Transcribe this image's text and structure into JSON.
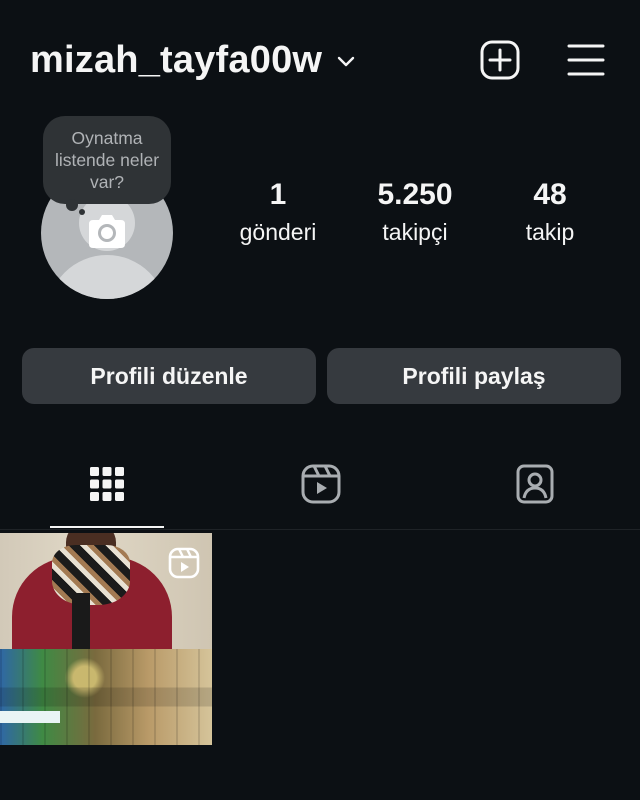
{
  "header": {
    "username": "mizah_tayfa00w",
    "icons": [
      "chevron-down-icon",
      "add-square-icon",
      "hamburger-menu-icon"
    ]
  },
  "profile": {
    "note_text": "Oynatma listende neler var?",
    "avatar_icon": "camera-icon",
    "stats": [
      {
        "value": "1",
        "label": "gönderi"
      },
      {
        "value": "5.250",
        "label": "takipçi"
      },
      {
        "value": "48",
        "label": "takip"
      }
    ]
  },
  "actions": {
    "edit_label": "Profili düzenle",
    "share_label": "Profili paylaş"
  },
  "tabs": [
    {
      "icon": "grid-icon",
      "selected": true
    },
    {
      "icon": "reels-icon",
      "selected": false
    },
    {
      "icon": "tagged-user-icon",
      "selected": false
    }
  ],
  "posts": [
    {
      "type": "reel",
      "badge_icon": "reel-badge-icon"
    }
  ],
  "colors": {
    "background": "#0c1014",
    "button": "#363a3f",
    "text": "#f5f5f5",
    "note_bubble": "#2f3336"
  }
}
